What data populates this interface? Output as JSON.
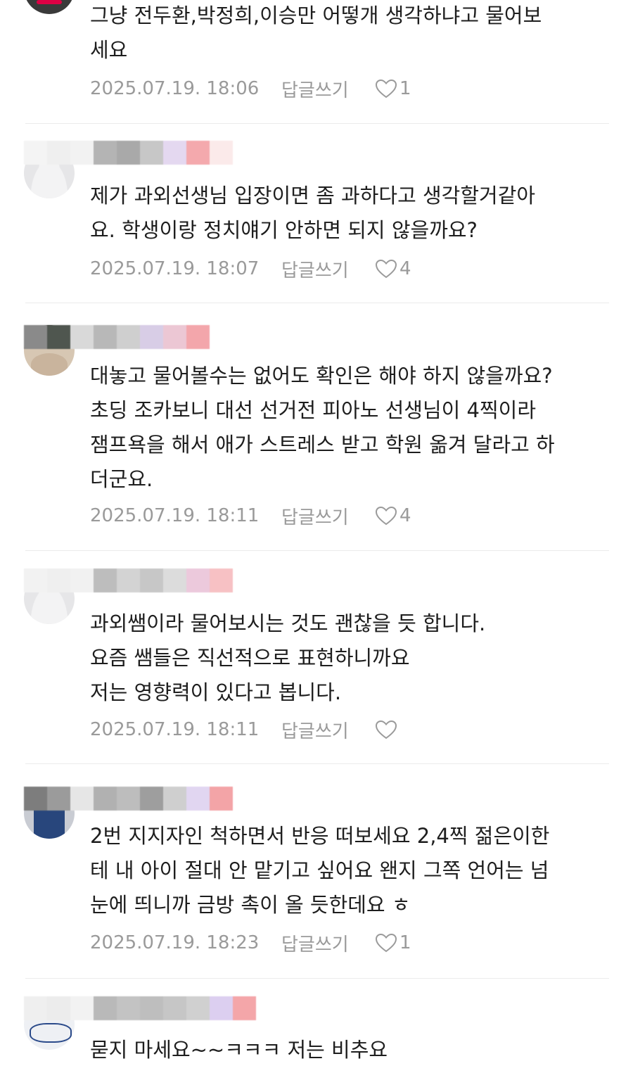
{
  "comments": [
    {
      "text": "그냥 전두환,박정희,이승만 어떻개 생각하냐고 물어보\n세요",
      "date": "2025.07.19. 18:06",
      "reply_label": "답글쓰기",
      "likes": "1"
    },
    {
      "text": "제가 과외선생님 입장이면 좀 과하다고 생각할거같아\n요. 학생이랑 정치얘기 안하면 되지 않을까요?",
      "date": "2025.07.19. 18:07",
      "reply_label": "답글쓰기",
      "likes": "4"
    },
    {
      "text": "대놓고 물어볼수는 없어도 확인은 해야 하지 않을까요?\n초딩 조카보니 대선 선거전 피아노 선생님이 4찍이라\n잼프욕을 해서 애가 스트레스 받고 학원 옮겨 달라고 하\n더군요.",
      "date": "2025.07.19. 18:11",
      "reply_label": "답글쓰기",
      "likes": "4"
    },
    {
      "text": "과외쌤이라 물어보시는 것도 괜찮을 듯 합니다.\n요즘 쌤들은 직선적으로 표현하니까요\n저는 영향력이 있다고 봅니다.",
      "date": "2025.07.19. 18:11",
      "reply_label": "답글쓰기",
      "likes": ""
    },
    {
      "text": "2번 지지자인 척하면서 반응 떠보세요 2,4찍 젊은이한\n테 내 아이 절대 안 맡기고 싶어요 왠지 그쪽 언어는 넘\n눈에 띄니까 금방 촉이 올 듯한데요 ㅎ",
      "date": "2025.07.19. 18:23",
      "reply_label": "답글쓰기",
      "likes": "1"
    },
    {
      "text": "묻지 마세요~~ㅋㅋㅋ 저는 비추요",
      "date": "",
      "reply_label": "",
      "likes": ""
    }
  ]
}
